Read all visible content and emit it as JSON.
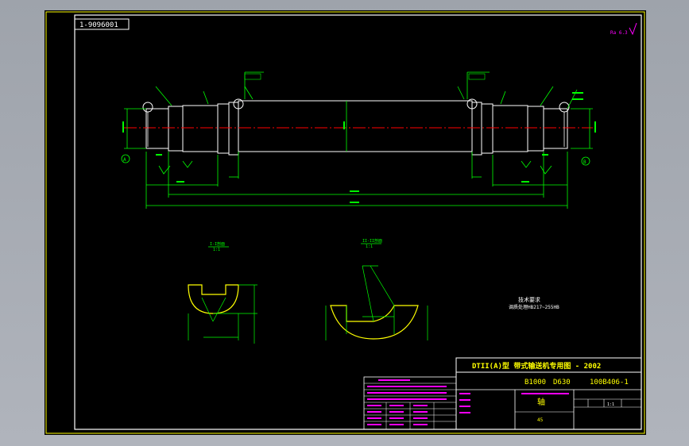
{
  "drawing": {
    "code_box": "1-9096001",
    "corner_mark": "Ra 6.3",
    "datum_a": "A",
    "datum_b": "B",
    "tech_title": "技术要求",
    "tech_line": "调质处理HB217~255HB",
    "section_a_title": "I-I剖面",
    "section_a_scale": "1:1",
    "section_b_title": "II-II剖面",
    "section_b_scale": "1:1"
  },
  "title_block": {
    "header": "DTII(A)型  带式输送机专用图 - 2002",
    "spec_1": "B1000",
    "spec_2": "D630",
    "drawing_no": "100B406-1",
    "part_name": "轴",
    "material": "45",
    "scale": "1:1",
    "weight": "",
    "sheet": ""
  },
  "colors": {
    "sheet_bg": "#000000",
    "line_white": "#ffffff",
    "line_yellow": "#ffff00",
    "line_green": "#00ff00",
    "line_red": "#ff0000",
    "line_cyan": "#00ffff",
    "line_magenta": "#ff00ff"
  }
}
